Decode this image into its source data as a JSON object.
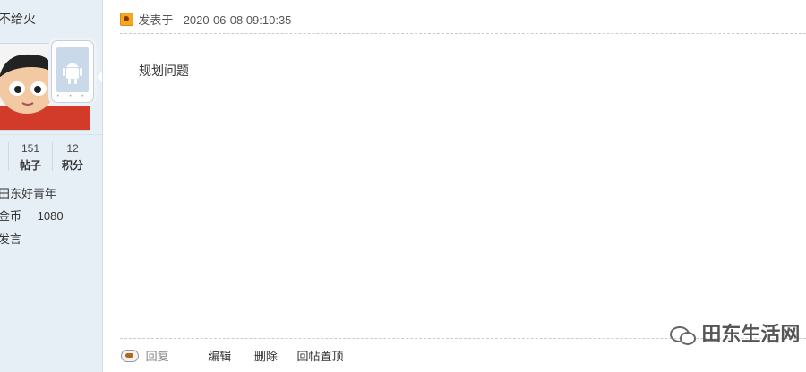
{
  "user": {
    "name": "不给火",
    "stats": [
      {
        "value": "151",
        "label": "帖子"
      },
      {
        "value": "12",
        "label": "积分"
      }
    ],
    "group": "田东好青年",
    "coins_label": "金币",
    "coins_value": "1080",
    "action": "发言"
  },
  "post": {
    "posted_label": "发表于",
    "timestamp": "2020-06-08 09:10:35",
    "content": "规划问题"
  },
  "actions": {
    "reply": "回复",
    "edit": "编辑",
    "delete": "删除",
    "pin": "回帖置顶"
  },
  "watermark": {
    "text": "田东生活网"
  },
  "icons": {
    "post": "post-author-icon",
    "reply": "coffee-cup-icon",
    "phone": "android-phone-icon",
    "watermark": "wechat-icon"
  }
}
